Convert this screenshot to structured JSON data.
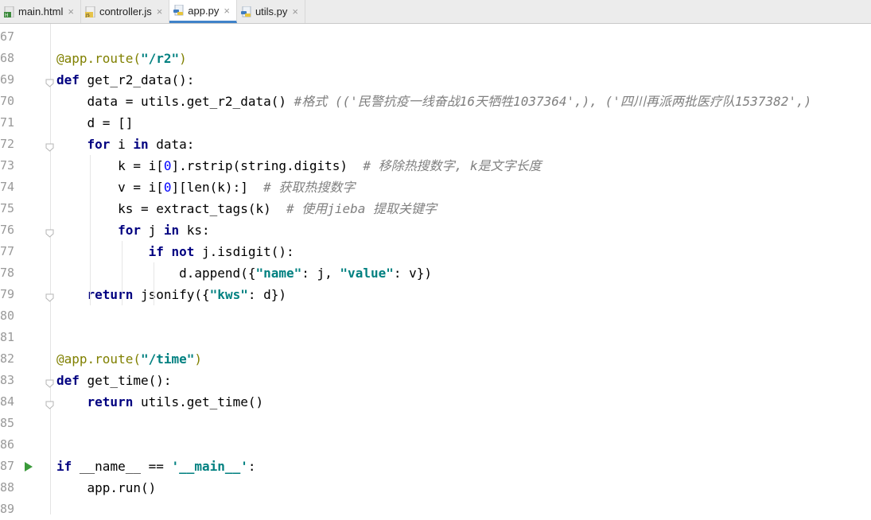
{
  "tabs": [
    {
      "label": "main.html",
      "type": "html-file-icon",
      "active": false
    },
    {
      "label": "controller.js",
      "type": "js-file-icon",
      "active": false
    },
    {
      "label": "app.py",
      "type": "python-file-icon",
      "active": true
    },
    {
      "label": "utils.py",
      "type": "python-file-icon",
      "active": false
    }
  ],
  "close_glyph": "×",
  "lines": [
    {
      "n": "67",
      "tokens": []
    },
    {
      "n": "68",
      "tokens": [
        [
          "dec",
          "@app.route("
        ],
        [
          "str",
          "\"/r2\""
        ],
        [
          "dec",
          ")"
        ]
      ]
    },
    {
      "n": "69",
      "tokens": [
        [
          "kw",
          "def "
        ],
        [
          "plain",
          "get_r2_data():"
        ]
      ]
    },
    {
      "n": "70",
      "tokens": [
        [
          "plain",
          "    data = utils.get_r2_data() "
        ],
        [
          "cmt",
          "#格式 (('民警抗疫一线奋战16天牺牲1037364',), ('四川再派两批医疗队1537382',)"
        ]
      ]
    },
    {
      "n": "71",
      "tokens": [
        [
          "plain",
          "    d = []"
        ]
      ]
    },
    {
      "n": "72",
      "tokens": [
        [
          "plain",
          "    "
        ],
        [
          "kw",
          "for "
        ],
        [
          "plain",
          "i "
        ],
        [
          "kw",
          "in "
        ],
        [
          "plain",
          "data:"
        ]
      ]
    },
    {
      "n": "73",
      "tokens": [
        [
          "plain",
          "        k = i["
        ],
        [
          "num",
          "0"
        ],
        [
          "plain",
          "].rstrip(string.digits)  "
        ],
        [
          "cmt",
          "# 移除热搜数字, k是文字长度"
        ]
      ]
    },
    {
      "n": "74",
      "tokens": [
        [
          "plain",
          "        v = i["
        ],
        [
          "num",
          "0"
        ],
        [
          "plain",
          "][len(k):]  "
        ],
        [
          "cmt",
          "# 获取热搜数字"
        ]
      ]
    },
    {
      "n": "75",
      "tokens": [
        [
          "plain",
          "        ks = extract_tags(k)  "
        ],
        [
          "cmt",
          "# 使用jieba 提取关键字"
        ]
      ]
    },
    {
      "n": "76",
      "tokens": [
        [
          "plain",
          "        "
        ],
        [
          "kw",
          "for "
        ],
        [
          "plain",
          "j "
        ],
        [
          "kw",
          "in "
        ],
        [
          "plain",
          "ks:"
        ]
      ]
    },
    {
      "n": "77",
      "tokens": [
        [
          "plain",
          "            "
        ],
        [
          "kw",
          "if not "
        ],
        [
          "plain",
          "j.isdigit():"
        ]
      ]
    },
    {
      "n": "78",
      "tokens": [
        [
          "plain",
          "                d.append({"
        ],
        [
          "str",
          "\"name\""
        ],
        [
          "plain",
          ": j, "
        ],
        [
          "str",
          "\"value\""
        ],
        [
          "plain",
          ": v})"
        ]
      ]
    },
    {
      "n": "79",
      "tokens": [
        [
          "plain",
          "    "
        ],
        [
          "kw",
          "return "
        ],
        [
          "plain",
          "jsonify({"
        ],
        [
          "str",
          "\"kws\""
        ],
        [
          "plain",
          ": d})"
        ]
      ]
    },
    {
      "n": "80",
      "tokens": []
    },
    {
      "n": "81",
      "tokens": []
    },
    {
      "n": "82",
      "tokens": [
        [
          "dec",
          "@app.route("
        ],
        [
          "str",
          "\"/time\""
        ],
        [
          "dec",
          ")"
        ]
      ]
    },
    {
      "n": "83",
      "tokens": [
        [
          "kw",
          "def "
        ],
        [
          "plain",
          "get_time():"
        ]
      ]
    },
    {
      "n": "84",
      "tokens": [
        [
          "plain",
          "    "
        ],
        [
          "kw",
          "return "
        ],
        [
          "plain",
          "utils.get_time()"
        ]
      ]
    },
    {
      "n": "85",
      "tokens": []
    },
    {
      "n": "86",
      "tokens": []
    },
    {
      "n": "87",
      "tokens": [
        [
          "kw",
          "if "
        ],
        [
          "plain",
          "__name__ == "
        ],
        [
          "str",
          "'__main__'"
        ],
        [
          "plain",
          ":"
        ]
      ]
    },
    {
      "n": "88",
      "tokens": [
        [
          "plain",
          "    app.run()"
        ]
      ]
    },
    {
      "n": "89",
      "tokens": []
    }
  ]
}
